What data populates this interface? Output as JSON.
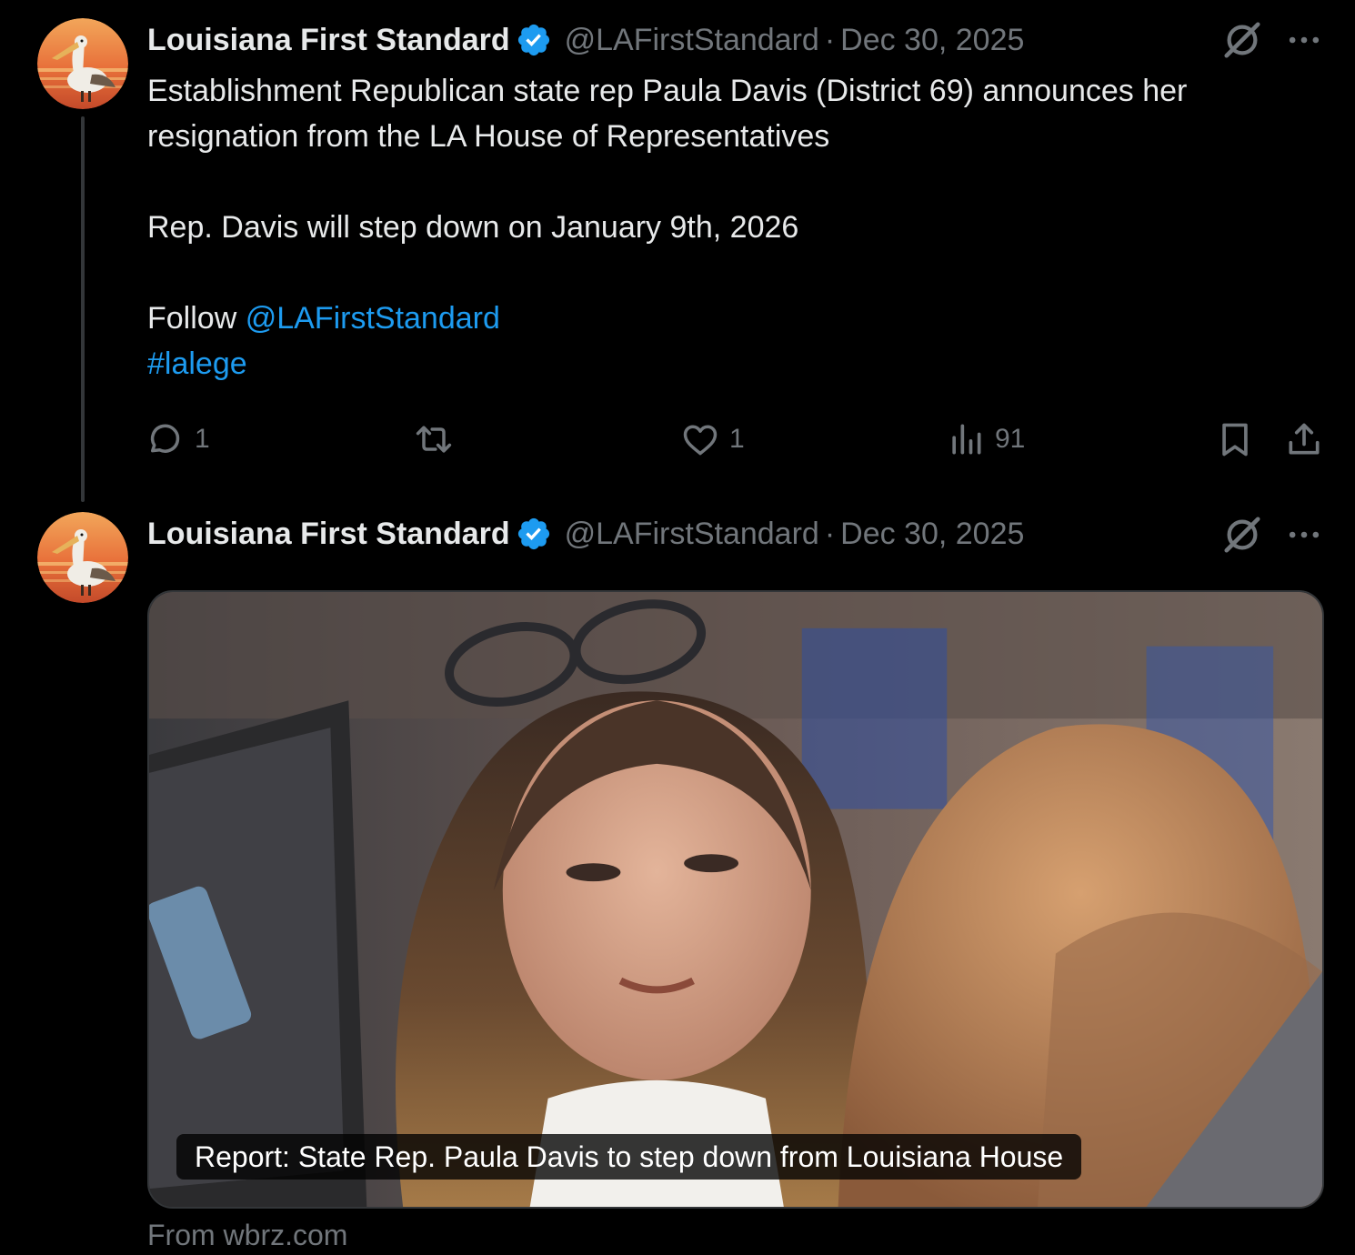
{
  "tweets": [
    {
      "author_name": "Louisiana First Standard",
      "handle": "@LAFirstStandard",
      "separator": "·",
      "date": "Dec 30, 2025",
      "text_line1": "Establishment Republican state rep Paula Davis (District 69) announces her",
      "text_line2": "resignation from the LA House of Representatives",
      "text_line3": "Rep. Davis will step down on January 9th, 2026",
      "follow_prefix": "Follow ",
      "follow_mention": "@LAFirstStandard",
      "hashtag": "#lalege",
      "stats": {
        "replies": "1",
        "retweets": "",
        "likes": "1",
        "views": "91"
      }
    },
    {
      "author_name": "Louisiana First Standard",
      "handle": "@LAFirstStandard",
      "separator": "·",
      "date": "Dec 30, 2025",
      "card_caption": "Report: State Rep. Paula Davis to step down from Louisiana House",
      "card_source": "From wbrz.com"
    }
  ],
  "icons": {
    "verified": "verified-badge-icon",
    "grok": "grok-icon",
    "more": "more-icon",
    "reply": "reply-icon",
    "retweet": "retweet-icon",
    "like": "heart-icon",
    "views": "views-icon",
    "bookmark": "bookmark-icon",
    "share": "share-icon"
  },
  "colors": {
    "background": "#000000",
    "text": "#e7e9ea",
    "muted": "#71767b",
    "link": "#1d9bf0",
    "verified": "#1d9bf0"
  }
}
